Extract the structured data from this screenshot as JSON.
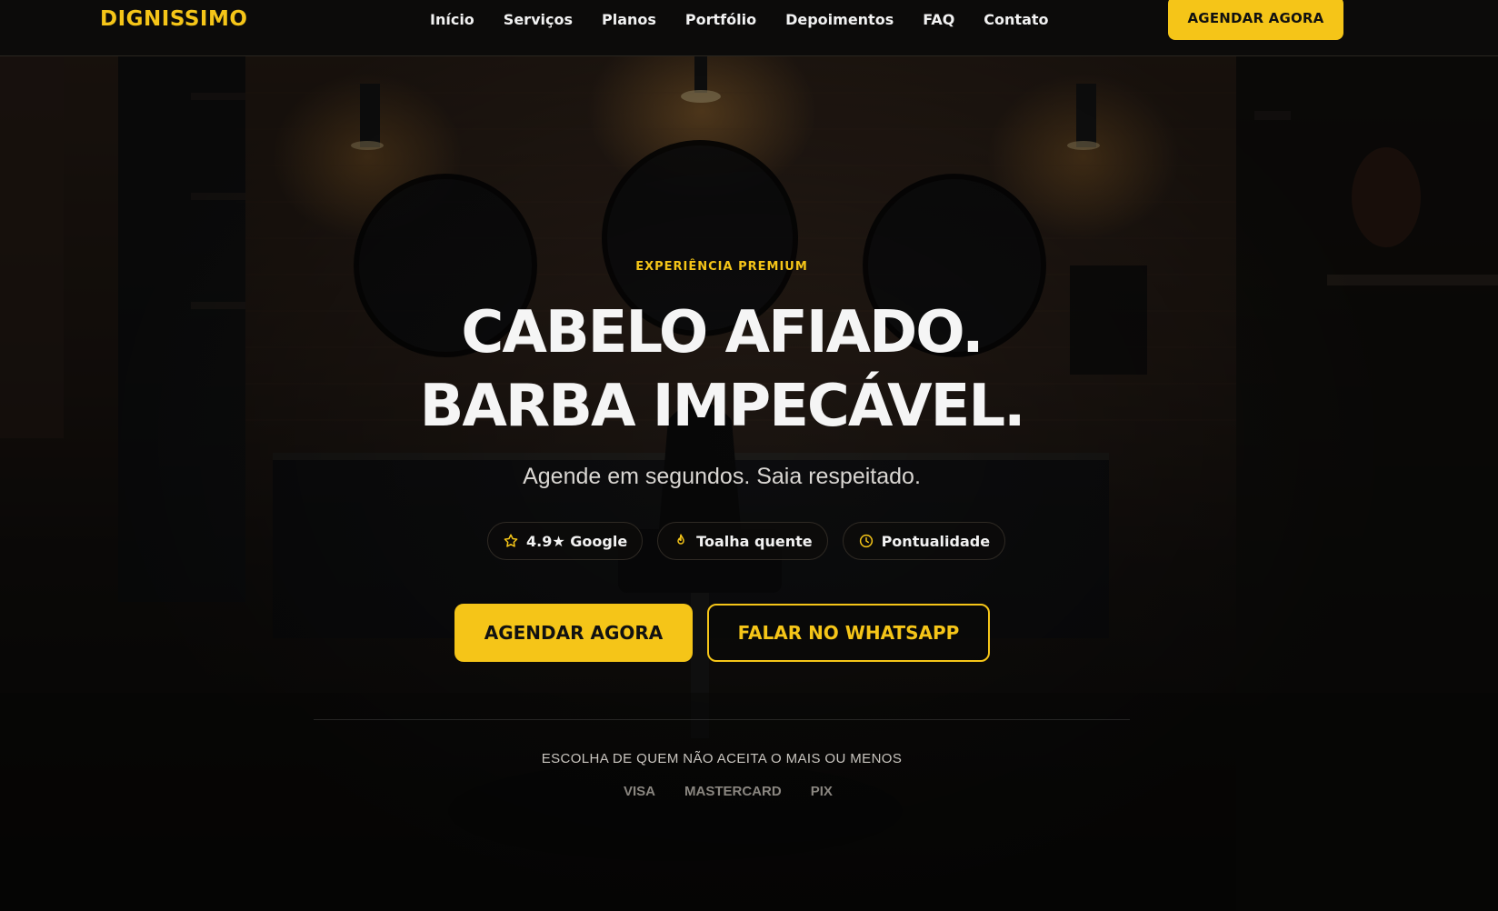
{
  "brand": {
    "name": "DIGNISSIMO",
    "accent_color": "#f5c518"
  },
  "nav": {
    "items": [
      {
        "label": "Início"
      },
      {
        "label": "Serviços"
      },
      {
        "label": "Planos"
      },
      {
        "label": "Portfólio"
      },
      {
        "label": "Depoimentos"
      },
      {
        "label": "FAQ"
      },
      {
        "label": "Contato"
      }
    ],
    "cta_label": "AGENDAR AGORA"
  },
  "hero": {
    "eyebrow": "EXPERIÊNCIA PREMIUM",
    "headline_line1": "CABELO AFIADO.",
    "headline_line2": "BARBA IMPECÁVEL.",
    "subtitle": "Agende em segundos. Saia respeitado.",
    "badges": [
      {
        "icon": "star-icon",
        "label": "4.9★ Google"
      },
      {
        "icon": "flame-icon",
        "label": "Toalha quente"
      },
      {
        "icon": "clock-icon",
        "label": "Pontualidade"
      }
    ],
    "primary_cta": "AGENDAR AGORA",
    "secondary_cta": "FALAR NO WHATSAPP",
    "tagline": "ESCOLHA DE QUEM NÃO ACEITA O MAIS OU MENOS",
    "payment_methods": [
      "VISA",
      "MASTERCARD",
      "PIX"
    ],
    "background_image": "barbershop interior"
  }
}
